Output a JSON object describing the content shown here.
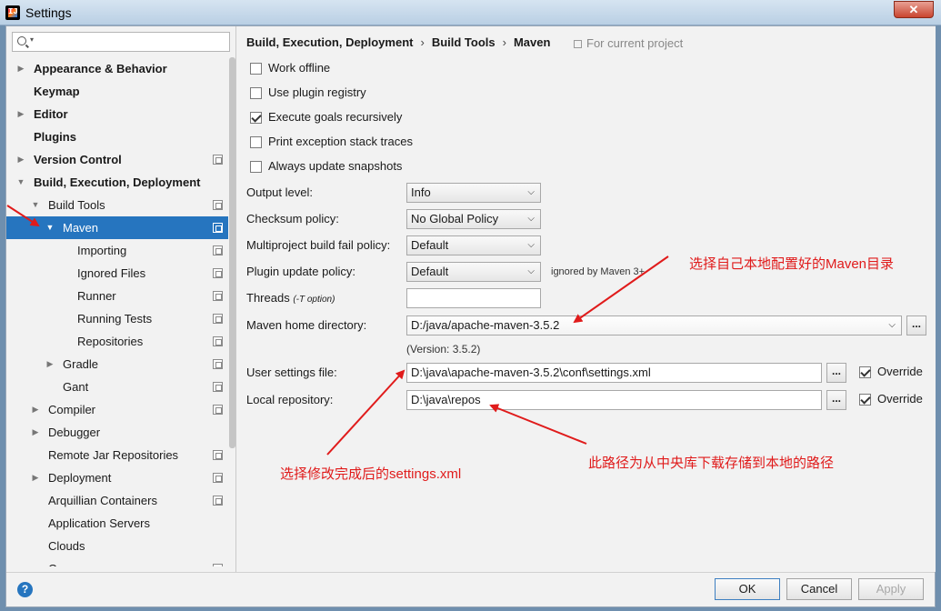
{
  "window": {
    "title": "Settings"
  },
  "sidebar": {
    "search_placeholder": "",
    "items": [
      {
        "label": "Appearance & Behavior",
        "level": 0,
        "bold": true,
        "arrow": "right",
        "proj": false
      },
      {
        "label": "Keymap",
        "level": 0,
        "bold": true,
        "arrow": "",
        "proj": false
      },
      {
        "label": "Editor",
        "level": 0,
        "bold": true,
        "arrow": "right",
        "proj": false
      },
      {
        "label": "Plugins",
        "level": 0,
        "bold": true,
        "arrow": "",
        "proj": false
      },
      {
        "label": "Version Control",
        "level": 0,
        "bold": true,
        "arrow": "right",
        "proj": true
      },
      {
        "label": "Build, Execution, Deployment",
        "level": 0,
        "bold": true,
        "arrow": "down",
        "proj": false
      },
      {
        "label": "Build Tools",
        "level": 1,
        "bold": false,
        "arrow": "down",
        "proj": true
      },
      {
        "label": "Maven",
        "level": 2,
        "bold": false,
        "arrow": "down",
        "proj": true,
        "selected": true
      },
      {
        "label": "Importing",
        "level": 3,
        "bold": false,
        "arrow": "",
        "proj": true
      },
      {
        "label": "Ignored Files",
        "level": 3,
        "bold": false,
        "arrow": "",
        "proj": true
      },
      {
        "label": "Runner",
        "level": 3,
        "bold": false,
        "arrow": "",
        "proj": true
      },
      {
        "label": "Running Tests",
        "level": 3,
        "bold": false,
        "arrow": "",
        "proj": true
      },
      {
        "label": "Repositories",
        "level": 3,
        "bold": false,
        "arrow": "",
        "proj": true
      },
      {
        "label": "Gradle",
        "level": 2,
        "bold": false,
        "arrow": "right",
        "proj": true
      },
      {
        "label": "Gant",
        "level": 2,
        "bold": false,
        "arrow": "",
        "proj": true
      },
      {
        "label": "Compiler",
        "level": 1,
        "bold": false,
        "arrow": "right",
        "proj": true
      },
      {
        "label": "Debugger",
        "level": 1,
        "bold": false,
        "arrow": "right",
        "proj": false
      },
      {
        "label": "Remote Jar Repositories",
        "level": 1,
        "bold": false,
        "arrow": "",
        "proj": true
      },
      {
        "label": "Deployment",
        "level": 1,
        "bold": false,
        "arrow": "right",
        "proj": true
      },
      {
        "label": "Arquillian Containers",
        "level": 1,
        "bold": false,
        "arrow": "",
        "proj": true
      },
      {
        "label": "Application Servers",
        "level": 1,
        "bold": false,
        "arrow": "",
        "proj": false
      },
      {
        "label": "Clouds",
        "level": 1,
        "bold": false,
        "arrow": "",
        "proj": false
      },
      {
        "label": "Coverage",
        "level": 1,
        "bold": false,
        "arrow": "",
        "proj": true
      }
    ]
  },
  "breadcrumb": {
    "part1": "Build, Execution, Deployment",
    "sep": "›",
    "part2": "Build Tools",
    "part3": "Maven",
    "hint": "For current project"
  },
  "checkboxes": {
    "work_offline": {
      "label": "Work offline",
      "checked": false
    },
    "plugin_registry": {
      "label": "Use plugin registry",
      "checked": false
    },
    "execute_goals": {
      "label": "Execute goals recursively",
      "checked": true
    },
    "print_exception": {
      "label": "Print exception stack traces",
      "checked": false
    },
    "always_update": {
      "label": "Always update snapshots",
      "checked": false
    }
  },
  "form": {
    "output_level": {
      "label": "Output level:",
      "value": "Info"
    },
    "checksum_policy": {
      "label": "Checksum policy:",
      "value": "No Global Policy"
    },
    "multiproject_policy": {
      "label": "Multiproject build fail policy:",
      "value": "Default"
    },
    "plugin_update_policy": {
      "label": "Plugin update policy:",
      "value": "Default",
      "note": "ignored by Maven 3+"
    },
    "threads": {
      "label": "Threads",
      "hint": "(-T option)",
      "value": ""
    },
    "maven_home": {
      "label": "Maven home directory:",
      "value": "D:/java/apache-maven-3.5.2",
      "version": "(Version: 3.5.2)"
    },
    "user_settings": {
      "label": "User settings file:",
      "value": "D:\\java\\apache-maven-3.5.2\\conf\\settings.xml",
      "override_label": "Override",
      "override_checked": true
    },
    "local_repo": {
      "label": "Local repository:",
      "value": "D:\\java\\repos",
      "override_label": "Override",
      "override_checked": true
    },
    "browse_label": "..."
  },
  "annotations": {
    "maven_home_note": "选择自己本地配置好的Maven目录",
    "settings_note": "选择修改完成后的settings.xml",
    "repo_note": "此路径为从中央库下载存储到本地的路径"
  },
  "buttons": {
    "ok": "OK",
    "cancel": "Cancel",
    "apply": "Apply",
    "help": "?"
  },
  "colors": {
    "selection": "#2675bf",
    "annotation": "#e01b1b"
  }
}
